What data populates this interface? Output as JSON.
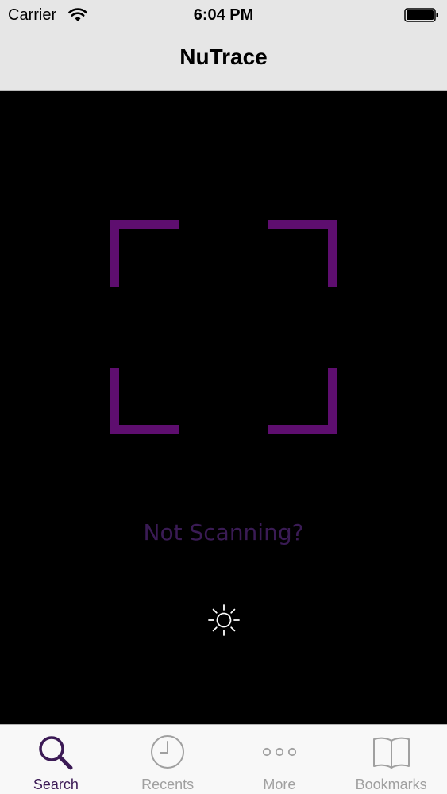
{
  "status_bar": {
    "carrier": "Carrier",
    "time": "6:04 PM",
    "wifi_icon": "wifi-icon",
    "battery_icon": "battery-icon"
  },
  "nav": {
    "title": "NuTrace"
  },
  "scanner": {
    "frame_color": "#5e0e6f",
    "help_text": "Not Scanning?",
    "help_text_color": "#3a1b55",
    "torch_icon": "sun-icon"
  },
  "tab_bar": {
    "active_color": "#3b1a55",
    "inactive_color": "#a0a0a0",
    "tabs": [
      {
        "label": "Search",
        "icon": "search-icon",
        "active": true
      },
      {
        "label": "Recents",
        "icon": "clock-icon",
        "active": false
      },
      {
        "label": "More",
        "icon": "more-icon",
        "active": false
      },
      {
        "label": "Bookmarks",
        "icon": "book-icon",
        "active": false
      }
    ]
  }
}
